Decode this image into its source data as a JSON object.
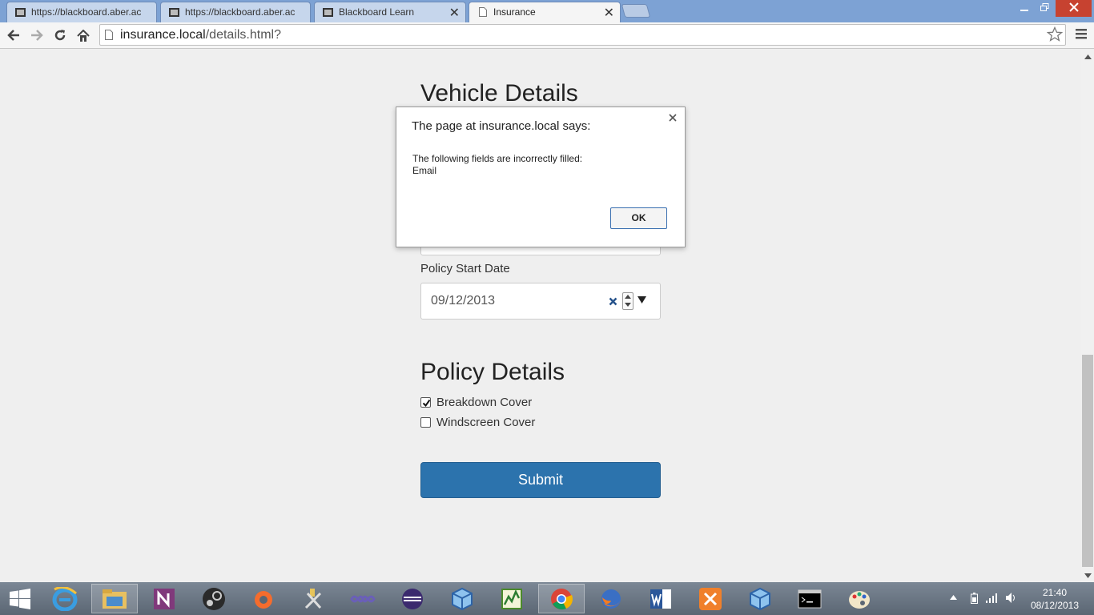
{
  "browser": {
    "tabs": [
      {
        "label": "https://blackboard.aber.ac",
        "active": false
      },
      {
        "label": "https://blackboard.aber.ac",
        "active": false
      },
      {
        "label": "Blackboard Learn",
        "active": false
      },
      {
        "label": "Insurance",
        "active": true
      }
    ],
    "close_glyph": "✕",
    "url_host": "insurance.local",
    "url_path": "/details.html?",
    "window_controls": [
      "minimize",
      "restore",
      "close"
    ]
  },
  "page": {
    "vehicle_section_title": "Vehicle Details",
    "policy_start_label": "Policy Start Date",
    "policy_start_value": "09/12/2013",
    "policy_section_title": "Policy Details",
    "checkboxes": [
      {
        "label": "Breakdown Cover",
        "checked": true
      },
      {
        "label": "Windscreen Cover",
        "checked": false
      }
    ],
    "submit_label": "Submit"
  },
  "dialog": {
    "title": "The page at insurance.local says:",
    "message_line1": "The following fields are incorrectly filled:",
    "message_line2": "Email",
    "ok_label": "OK"
  },
  "taskbar": {
    "apps": [
      "internet-explorer",
      "file-explorer",
      "onenote",
      "steam",
      "origin",
      "tools",
      "visual-studio",
      "eclipse",
      "virtualbox",
      "chart-app",
      "chrome",
      "firefox",
      "word",
      "xampp",
      "virtualbox",
      "command-prompt",
      "paint"
    ],
    "time": "21:40",
    "date": "08/12/2013"
  },
  "colors": {
    "accent": "#2c73ad",
    "titlebar": "#7da2d4",
    "close_button": "#c74230"
  }
}
